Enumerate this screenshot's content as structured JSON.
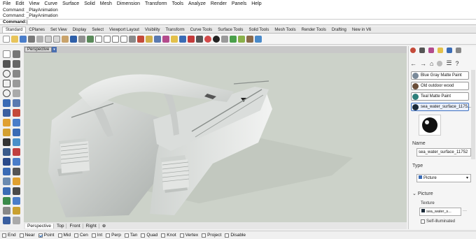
{
  "menu": [
    "File",
    "Edit",
    "View",
    "Curve",
    "Surface",
    "Solid",
    "Mesh",
    "Dimension",
    "Transform",
    "Tools",
    "Analyze",
    "Render",
    "Panels",
    "Help"
  ],
  "command_history": [
    "Command: _PlayAnimation",
    "Command: _PlayAnimation"
  ],
  "command_prompt": "Command:",
  "toolbar_tabs": [
    "Standard",
    "CPlanes",
    "Set View",
    "Display",
    "Select",
    "Viewport Layout",
    "Visibility",
    "Transform",
    "Curve Tools",
    "Surface Tools",
    "Solid Tools",
    "Mesh Tools",
    "Render Tools",
    "Drafting",
    "New in V6"
  ],
  "active_toolbar_tab": "Standard",
  "viewport": {
    "title": "Perspective",
    "dropdown_glyph": "▾",
    "tabs": [
      "Perspective",
      "Top",
      "Front",
      "Right"
    ],
    "add_tab_glyph": "⊕",
    "background": "#ccd2c9"
  },
  "snaps": [
    {
      "label": "End",
      "checked": false
    },
    {
      "label": "Near",
      "checked": false
    },
    {
      "label": "Point",
      "checked": true
    },
    {
      "label": "Mid",
      "checked": false
    },
    {
      "label": "Cen",
      "checked": false
    },
    {
      "label": "Int",
      "checked": false
    },
    {
      "label": "Perp",
      "checked": false
    },
    {
      "label": "Tan",
      "checked": false
    },
    {
      "label": "Quad",
      "checked": false
    },
    {
      "label": "Knot",
      "checked": false
    },
    {
      "label": "Vertex",
      "checked": false
    },
    {
      "label": "Project",
      "checked": false
    },
    {
      "label": "Disable",
      "checked": false
    }
  ],
  "panel": {
    "nav": {
      "back": "←",
      "forward": "→",
      "home": "⌂",
      "menu": "☰",
      "help": "?"
    },
    "materials": [
      {
        "name": "Blue Gray Matte Paint",
        "swatch": "#7a8a9a"
      },
      {
        "name": "Old outdoor wood",
        "swatch": "#6b4f3a"
      },
      {
        "name": "Teal Matte Paint",
        "swatch": "#2e7f7a"
      },
      {
        "name": "sea_water_surface_1175...",
        "swatch": "#1b2a38"
      }
    ],
    "name_label": "Name",
    "name_value": "sea_water_surface_11752",
    "type_label": "Type",
    "type_value": "Picture",
    "picture_label": "Picture",
    "texture_label": "Texture",
    "texture_value": "sea_water_s...",
    "texture_more": "···",
    "self_illuminated_label": "Self-illuminated"
  }
}
